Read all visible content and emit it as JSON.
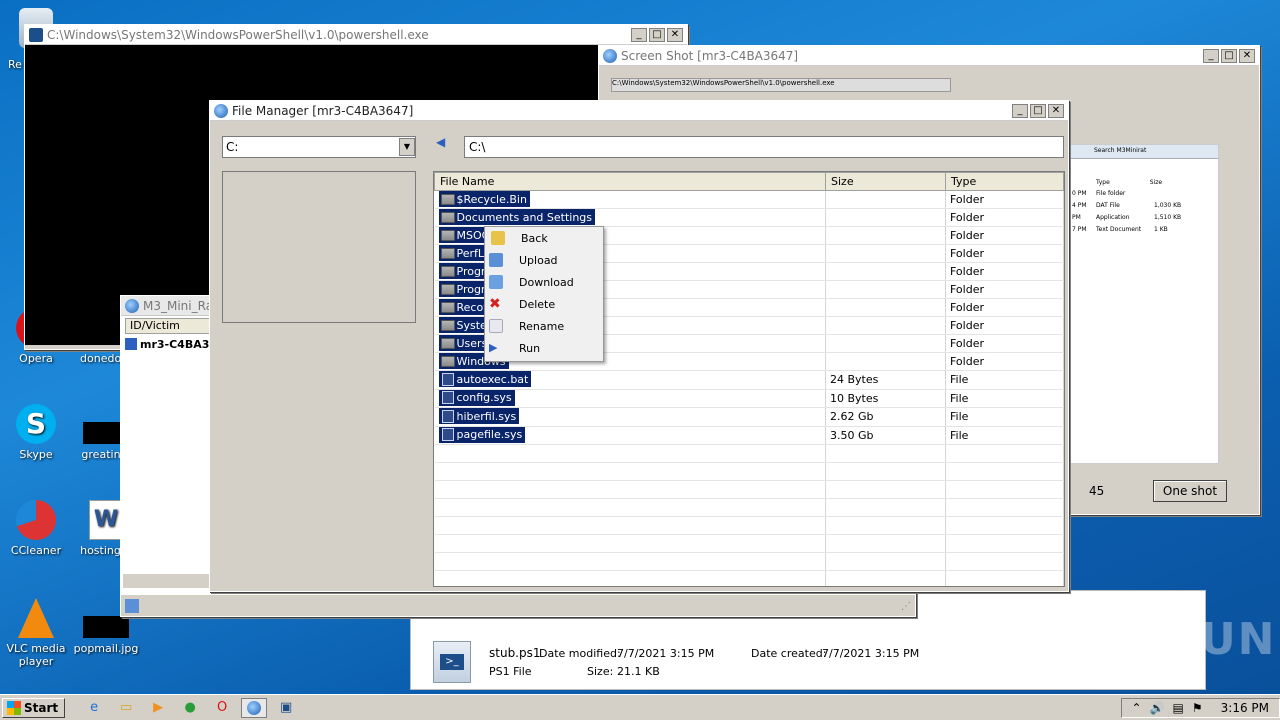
{
  "desktop": {
    "icons": [
      {
        "label": "Re"
      },
      {
        "label": "Opera"
      },
      {
        "label": "donedom"
      },
      {
        "label": "Skype"
      },
      {
        "label": "greatindi"
      },
      {
        "label": "CCleaner"
      },
      {
        "label": "hostingre"
      },
      {
        "label": "VLC media player"
      },
      {
        "label": "popmail.jpg"
      }
    ]
  },
  "powershell": {
    "title": "C:\\Windows\\System32\\WindowsPowerShell\\v1.0\\powershell.exe"
  },
  "screenshot_win": {
    "title": "Screen Shot [mr3-C4BA3647]",
    "inner_title": "C:\\Windows\\System32\\WindowsPowerShell\\v1.0\\powershell.exe",
    "search_placeholder": "Search M3Minirat",
    "col_type": "Type",
    "col_size": "Size",
    "rows": [
      {
        "time": "0 PM",
        "type": "File folder",
        "size": ""
      },
      {
        "time": "4 PM",
        "type": "DAT File",
        "size": "1,030 KB"
      },
      {
        "time": "PM",
        "type": "Application",
        "size": "1,510 KB"
      },
      {
        "time": "7 PM",
        "type": "Text Document",
        "size": "1 KB"
      }
    ],
    "counter": "45",
    "one_shot_label": "One shot"
  },
  "minirat": {
    "title": "M3_Mini_Ra",
    "col_id": "ID/Victim",
    "row_label": "mr3-C4BA3"
  },
  "file_manager": {
    "title": "File Manager [mr3-C4BA3647]",
    "drive": "C:",
    "path": "C:\\",
    "columns": {
      "name": "File Name",
      "size": "Size",
      "type": "Type"
    },
    "files": [
      {
        "name": "$Recycle.Bin",
        "size": "",
        "type": "Folder",
        "kind": "folder"
      },
      {
        "name": "Documents and Settings",
        "size": "",
        "type": "Folder",
        "kind": "folder"
      },
      {
        "name": "MSOC",
        "size": "",
        "type": "Folder",
        "kind": "folder"
      },
      {
        "name": "PerfL",
        "size": "",
        "type": "Folder",
        "kind": "folder"
      },
      {
        "name": "Progra",
        "size": "",
        "type": "Folder",
        "kind": "folder"
      },
      {
        "name": "Progra",
        "size": "",
        "type": "Folder",
        "kind": "folder"
      },
      {
        "name": "Recov",
        "size": "",
        "type": "Folder",
        "kind": "folder"
      },
      {
        "name": "Syste",
        "size": "",
        "type": "Folder",
        "kind": "folder"
      },
      {
        "name": "Users",
        "size": "",
        "type": "Folder",
        "kind": "folder"
      },
      {
        "name": "Windows",
        "size": "",
        "type": "Folder",
        "kind": "folder"
      },
      {
        "name": "autoexec.bat",
        "size": "24 Bytes",
        "type": "File",
        "kind": "file"
      },
      {
        "name": "config.sys",
        "size": "10 Bytes",
        "type": "File",
        "kind": "file"
      },
      {
        "name": "hiberfil.sys",
        "size": "2.62 Gb",
        "type": "File",
        "kind": "file"
      },
      {
        "name": "pagefile.sys",
        "size": "3.50 Gb",
        "type": "File",
        "kind": "file"
      }
    ]
  },
  "context_menu": {
    "items": [
      {
        "label": "Back",
        "color": "#e8c34a"
      },
      {
        "label": "Upload",
        "color": "#5b8fd6"
      },
      {
        "label": "Download",
        "color": "#6a9fe0"
      },
      {
        "label": "Delete",
        "color": "#d42020"
      },
      {
        "label": "Rename",
        "color": "#e8e8f0"
      },
      {
        "label": "Run",
        "color": "#2c5fc0"
      }
    ]
  },
  "explorer_details": {
    "filename": "stub.ps1",
    "date_modified_label": "Date modified:",
    "date_modified": "7/7/2021 3:15 PM",
    "date_created_label": "Date created:",
    "date_created": "7/7/2021 3:15 PM",
    "filetype": "PS1 File",
    "size_label": "Size:",
    "size": "21.1 KB"
  },
  "watermark": "ANY RUN",
  "taskbar": {
    "start_label": "Start",
    "clock": "3:16 PM"
  }
}
